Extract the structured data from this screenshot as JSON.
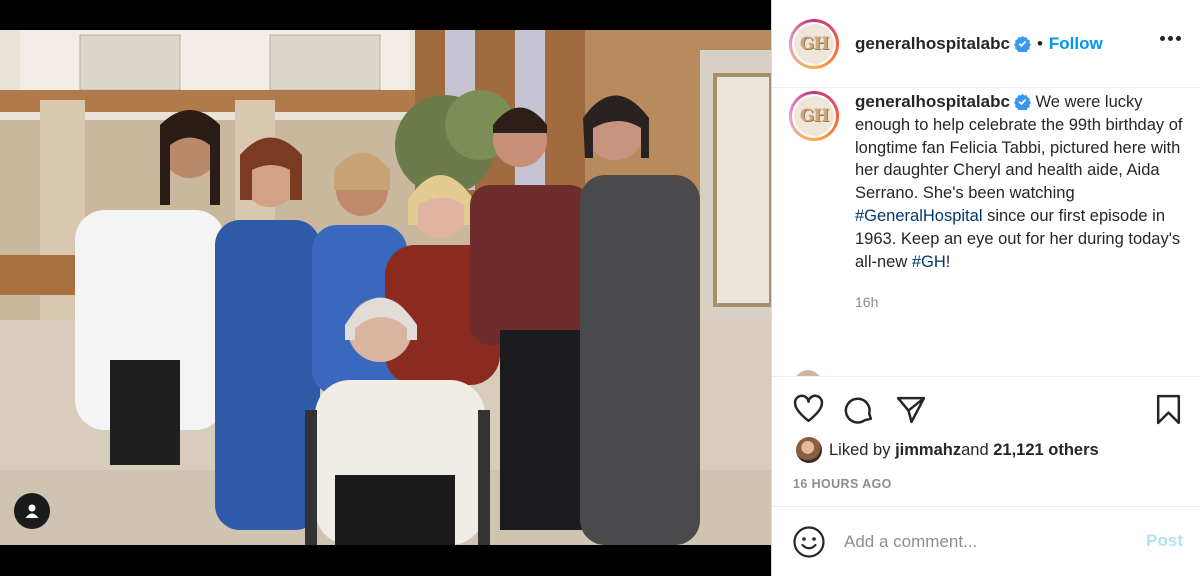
{
  "header": {
    "username": "generalhospitalabc",
    "verified": true,
    "separator": "•",
    "follow_label": "Follow",
    "avatar_initials": "GH",
    "more_icon": "more-horizontal-icon"
  },
  "caption": {
    "username": "generalhospitalabc",
    "text_part1": "We were lucky enough to help celebrate the 99th birthday of longtime fan Felicia Tabbi, pictured here with her daughter Cheryl and health aide, Aida Serrano. She's been watching ",
    "hashtag1": "#GeneralHospital",
    "text_part2": " since our first episode in 1963. Keep an eye out for her during today's all-new ",
    "hashtag2": "#GH",
    "text_part3": "!",
    "time": "16h"
  },
  "actions": {
    "icons": [
      "heart-icon",
      "comment-icon",
      "share-icon",
      "bookmark-icon"
    ],
    "liked_prefix": "Liked by ",
    "liked_user": "jimmahz",
    "liked_middle": " and ",
    "liked_count": "21,121 others",
    "timestamp": "16 HOURS AGO"
  },
  "comment_box": {
    "placeholder": "Add a comment...",
    "post_label": "Post",
    "emoji_icon": "emoji-icon"
  },
  "media": {
    "user_tag_icon": "user-tag-icon"
  },
  "colors": {
    "link": "#0095f6",
    "hashtag": "#00376b",
    "muted": "#8e8e8e",
    "post_disabled": "#b2dffc"
  }
}
